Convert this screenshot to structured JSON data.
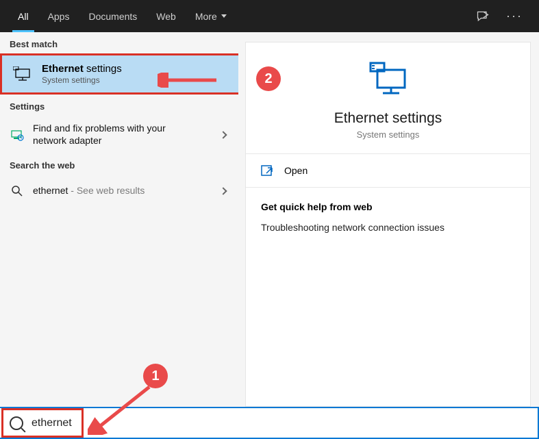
{
  "tabs": {
    "all": "All",
    "apps": "Apps",
    "documents": "Documents",
    "web": "Web",
    "more": "More"
  },
  "left": {
    "best_match_heading": "Best match",
    "best_match": {
      "title_bold": "Ethernet",
      "title_rest": " settings",
      "subtitle": "System settings"
    },
    "settings_heading": "Settings",
    "settings_item": "Find and fix problems with your network adapter",
    "web_heading": "Search the web",
    "web_query": "ethernet",
    "web_hint": " - See web results"
  },
  "preview": {
    "title": "Ethernet settings",
    "subtitle": "System settings",
    "open_label": "Open",
    "help_heading": "Get quick help from web",
    "help_link": "Troubleshooting network connection issues"
  },
  "search": {
    "value": "ethernet"
  }
}
